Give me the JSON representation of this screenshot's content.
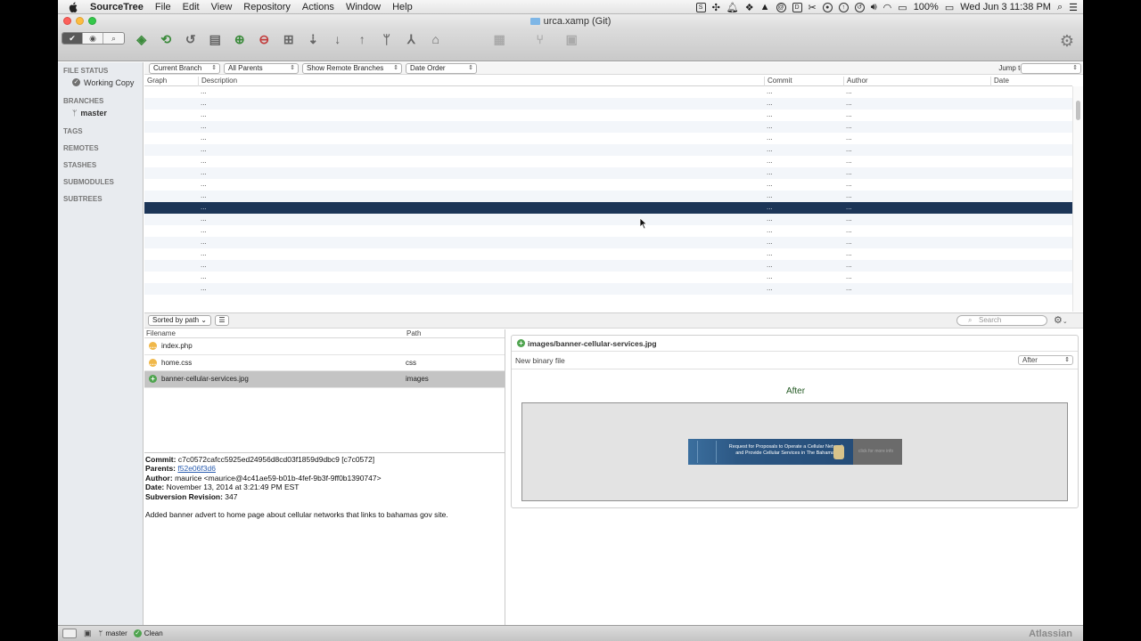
{
  "menubar": {
    "app_name": "SourceTree",
    "menus": [
      "File",
      "Edit",
      "View",
      "Repository",
      "Actions",
      "Window",
      "Help"
    ],
    "battery": "100%",
    "clock": "Wed Jun 3  11:38 PM"
  },
  "window": {
    "title": "urca.xamp (Git)"
  },
  "toolbar": {
    "gear_label": "Settings"
  },
  "sidebar": {
    "sections": {
      "file_status": "FILE STATUS",
      "working_copy": "Working Copy",
      "branches": "BRANCHES",
      "master": "master",
      "tags": "TAGS",
      "remotes": "REMOTES",
      "stashes": "STASHES",
      "submodules": "SUBMODULES",
      "subtrees": "SUBTREES"
    }
  },
  "filters": {
    "branch": "Current Branch",
    "parents": "All Parents",
    "remote": "Show Remote Branches",
    "order": "Date Order",
    "jump_to": "Jump to:"
  },
  "history": {
    "columns": {
      "graph": "Graph",
      "description": "Description",
      "commit": "Commit",
      "author": "Author",
      "date": "Date"
    },
    "rows": [
      {
        "description": "...",
        "commit": "...",
        "author": "..."
      },
      {
        "description": "...",
        "commit": "...",
        "author": "..."
      },
      {
        "description": "...",
        "commit": "...",
        "author": "..."
      },
      {
        "description": "...",
        "commit": "...",
        "author": "..."
      },
      {
        "description": "...",
        "commit": "...",
        "author": "..."
      },
      {
        "description": "...",
        "commit": "...",
        "author": "..."
      },
      {
        "description": "...",
        "commit": "...",
        "author": "..."
      },
      {
        "description": "...",
        "commit": "...",
        "author": "..."
      },
      {
        "description": "...",
        "commit": "...",
        "author": "..."
      },
      {
        "description": "...",
        "commit": "...",
        "author": "..."
      },
      {
        "description": "...",
        "commit": "...",
        "author": "...",
        "selected": true
      },
      {
        "description": "...",
        "commit": "...",
        "author": "..."
      },
      {
        "description": "...",
        "commit": "...",
        "author": "..."
      },
      {
        "description": "...",
        "commit": "...",
        "author": "..."
      },
      {
        "description": "...",
        "commit": "...",
        "author": "..."
      },
      {
        "description": "...",
        "commit": "...",
        "author": "..."
      },
      {
        "description": "...",
        "commit": "...",
        "author": "..."
      },
      {
        "description": "...",
        "commit": "...",
        "author": "..."
      }
    ]
  },
  "files_toolbar": {
    "sort": "Sorted by path",
    "search_placeholder": "Search"
  },
  "files": {
    "columns": {
      "filename": "Filename",
      "path": "Path"
    },
    "rows": [
      {
        "name": "index.php",
        "path": "",
        "status": "modified"
      },
      {
        "name": "home.css",
        "path": "css",
        "status": "modified"
      },
      {
        "name": "banner-cellular-services.jpg",
        "path": "images",
        "status": "added"
      }
    ]
  },
  "commit": {
    "commit_label": "Commit:",
    "commit_value": "c7c0572cafcc5925ed24956d8cd03f1859d9dbc9 [c7c0572]",
    "parents_label": "Parents:",
    "parents_value": "f52e06f3d6",
    "author_label": "Author:",
    "author_value": "maurice <maurice@4c41ae59-b01b-4fef-9b3f-9ff0b1390747>",
    "date_label": "Date:",
    "date_value": "November 13, 2014 at 3:21:49 PM EST",
    "svn_label": "Subversion Revision:",
    "svn_value": "347",
    "message": "Added banner advert to home page about cellular networks that links to bahamas gov site."
  },
  "diff": {
    "file": "images/banner-cellular-services.jpg",
    "subtitle": "New binary file",
    "view_option": "After",
    "after_title": "After",
    "banner_text_line1": "Request for Proposals to Operate a Cellular Network",
    "banner_text_line2": "and Provide Cellular Services in The Bahamas",
    "banner_right": "click for more info"
  },
  "statusbar": {
    "branch": "master",
    "state": "Clean",
    "brand": "Atlassian"
  },
  "colors": {
    "selected_row": "#1c3557",
    "added": "#4fa44f",
    "modified": "#f0b84a"
  }
}
